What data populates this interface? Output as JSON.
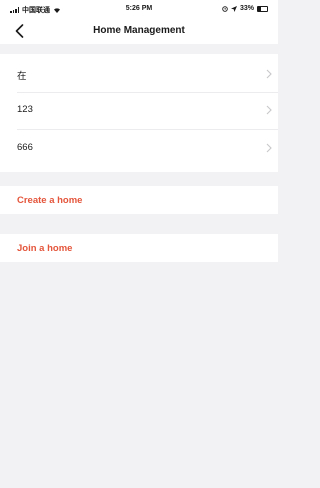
{
  "status_bar": {
    "carrier": "中国联通",
    "time": "5:26 PM",
    "battery": "33%"
  },
  "nav": {
    "title": "Home Management",
    "back_icon": "chevron-left-icon"
  },
  "homes": [
    {
      "name": "在"
    },
    {
      "name": "123"
    },
    {
      "name": "666"
    }
  ],
  "actions": {
    "create": "Create a home",
    "join": "Join a home"
  },
  "colors": {
    "accent": "#e4553b",
    "background": "#f2f2f4",
    "surface": "#ffffff"
  }
}
